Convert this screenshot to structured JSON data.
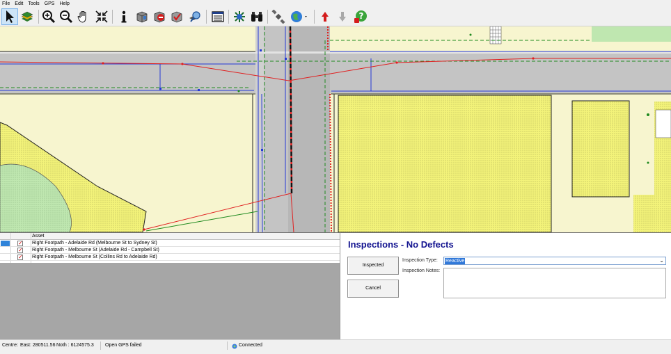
{
  "menu": [
    "File",
    "Edit",
    "Tools",
    "GPS",
    "Help"
  ],
  "toolbar": {
    "tools": [
      {
        "name": "select-tool",
        "icon": "pointer-arrow-icon",
        "active": true
      },
      {
        "name": "layers-tool",
        "icon": "layers-icon"
      },
      {
        "name": "zoom-in-tool",
        "icon": "zoom-in-icon"
      },
      {
        "name": "zoom-out-tool",
        "icon": "zoom-out-icon"
      },
      {
        "name": "pan-tool",
        "icon": "hand-icon"
      },
      {
        "name": "zoom-extents-tool",
        "icon": "zoom-extents-icon"
      },
      {
        "name": "identify-tool",
        "icon": "info-icon"
      },
      {
        "name": "asset-tool",
        "icon": "asset-icon"
      },
      {
        "name": "defect-tool",
        "icon": "defect-icon"
      },
      {
        "name": "inspection-tool",
        "icon": "inspection-icon"
      },
      {
        "name": "search-asset-tool",
        "icon": "asset-search-icon"
      },
      {
        "name": "list-tool",
        "icon": "list-window-icon"
      },
      {
        "name": "network-tool",
        "icon": "network-icon"
      },
      {
        "name": "find-tool",
        "icon": "binoculars-icon"
      },
      {
        "name": "gps-tool",
        "icon": "satellite-icon"
      },
      {
        "name": "globe-tool",
        "icon": "globe-icon"
      },
      {
        "name": "upload-tool",
        "icon": "up-arrow-icon"
      },
      {
        "name": "download-tool",
        "icon": "down-arrow-icon"
      },
      {
        "name": "help-tool",
        "icon": "help-icon"
      }
    ]
  },
  "asset_grid": {
    "header": "Asset",
    "rows": [
      {
        "label": "Right Footpath - Adelaide Rd (Melbourne St to Sydney St)",
        "checked": true,
        "selected": true
      },
      {
        "label": "Right Footpath - Melbourne St (Adelaide Rd - Campbell St)",
        "checked": true,
        "selected": false
      },
      {
        "label": "Right Footpath - Melbourne St (Collins Rd to Adelaide Rd)",
        "checked": true,
        "selected": false
      }
    ],
    "check_mark": "✓"
  },
  "inspection": {
    "title": "Inspections - No Defects",
    "inspected_button": "Inspected",
    "cancel_button": "Cancel",
    "type_label": "Inspection Type:",
    "type_value": "Reactive",
    "notes_label": "Inspection Notes:",
    "notes_value": ""
  },
  "status": {
    "centre_label": "Centre:",
    "east": "East: 280511.56",
    "north": "Noth : 6124575.3",
    "gps_message": "Open GPS failed",
    "connection": "Connected"
  },
  "colors": {
    "parcel_fill": "#f7f5cf",
    "road_fill": "#c4c4c4",
    "dotted_yellow": "#f3f37a",
    "green_area": "#bfe7b0",
    "title_blue": "#11128f",
    "blue_line": "#2338d6",
    "red_line": "#e02020"
  }
}
